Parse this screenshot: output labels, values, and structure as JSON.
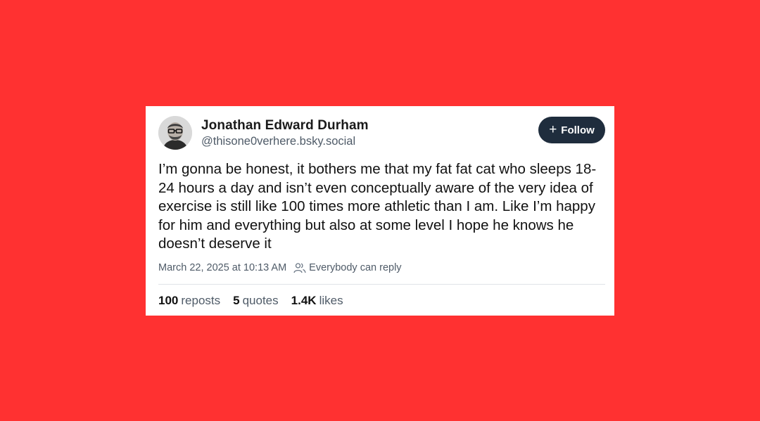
{
  "post": {
    "author_name": "Jonathan Edward Durham",
    "author_handle": "@thisone0verhere.bsky.social",
    "follow_label": "Follow",
    "text": "I’m gonna be honest, it bothers me that my fat fat cat who sleeps 18-24 hours a day and isn’t even conceptually aware of the very idea of exercise is still like 100 times more athletic than I am. Like I’m happy for him and everything but also at some level I hope he knows he doesn’t deserve it",
    "timestamp": "March 22, 2025 at 10:13 AM",
    "reply_setting": "Everybody can reply",
    "stats": {
      "reposts_count": "100",
      "reposts_label": "reposts",
      "quotes_count": "5",
      "quotes_label": "quotes",
      "likes_count": "1.4K",
      "likes_label": "likes"
    }
  },
  "colors": {
    "background": "#ff3131",
    "card": "#ffffff",
    "follow_button": "#1f2d3d",
    "secondary_text": "#4f5b68"
  },
  "icons": {
    "follow": "plus-icon",
    "reply_setting": "people-icon"
  }
}
